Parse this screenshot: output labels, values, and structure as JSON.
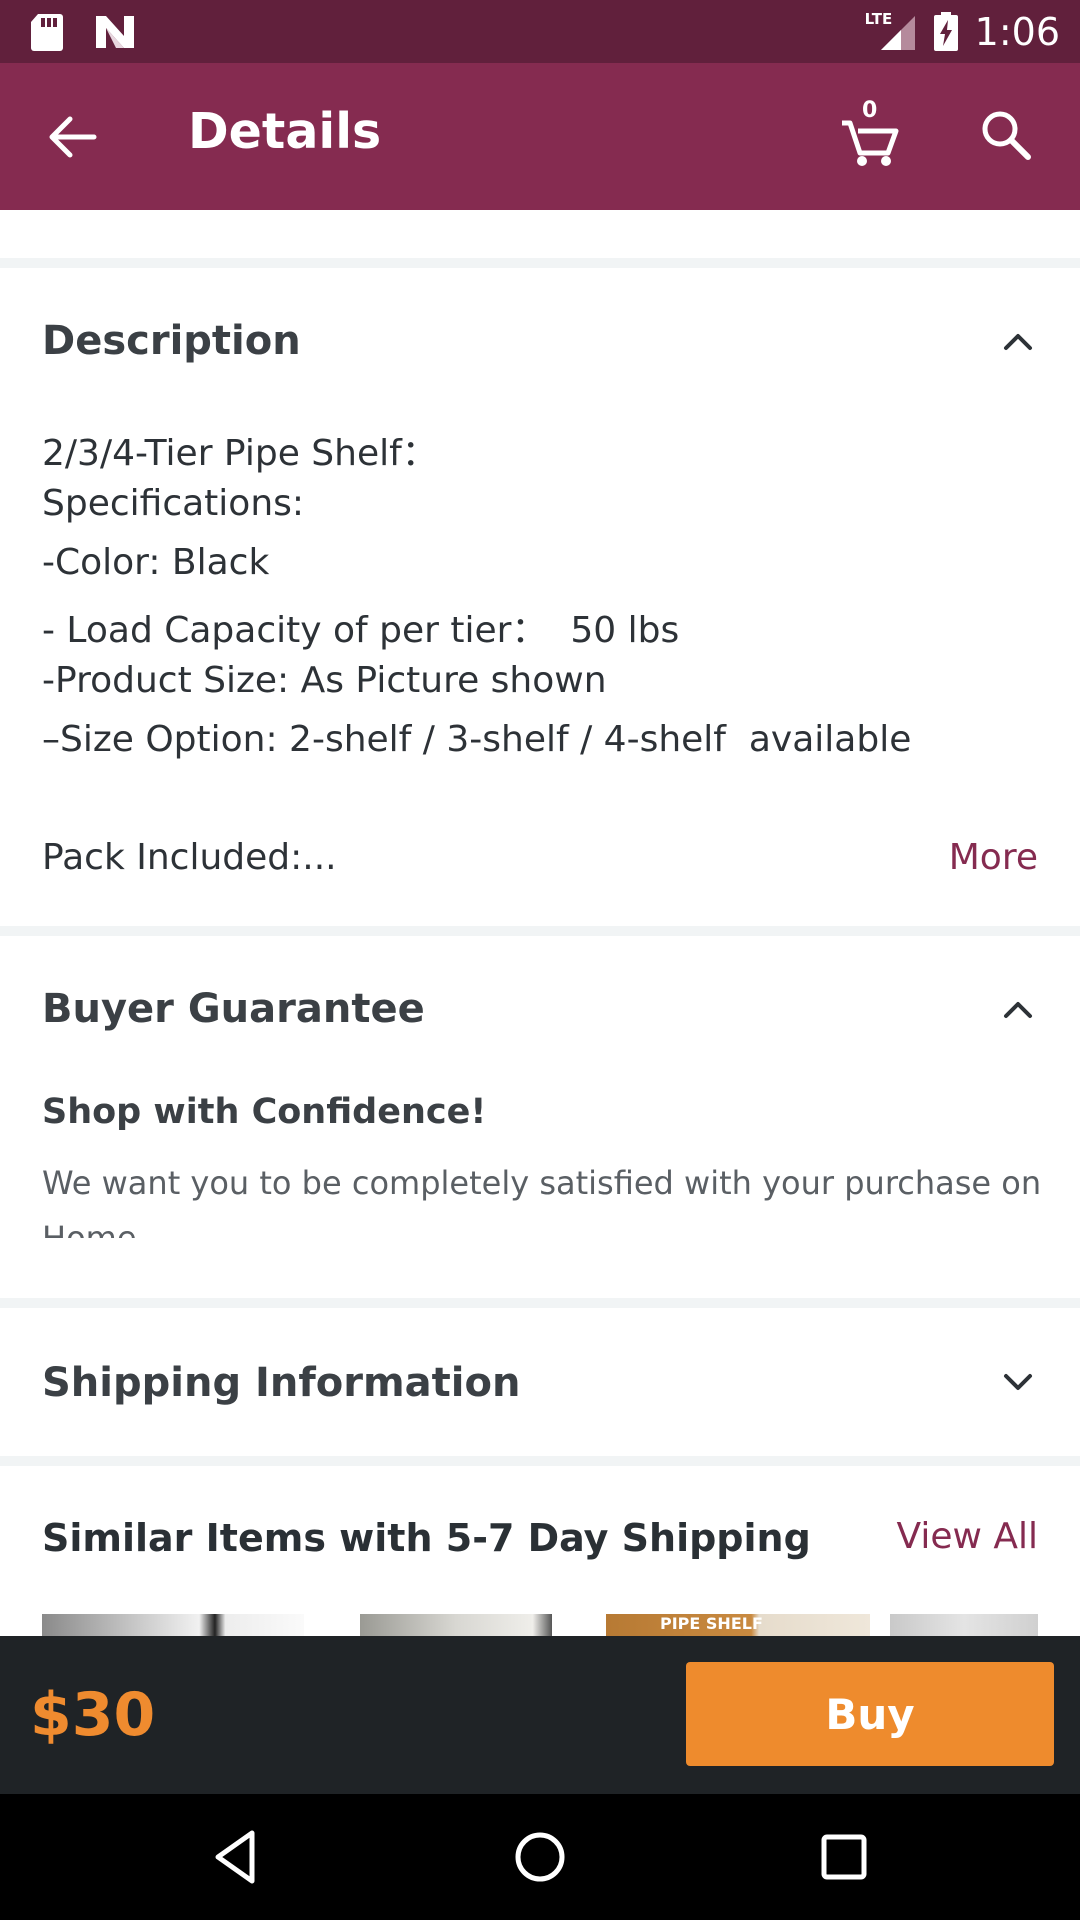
{
  "status_bar": {
    "time": "1:06",
    "network": "LTE",
    "icons": [
      "sd-card-icon",
      "n-logo-icon",
      "signal-icon",
      "battery-charging-icon"
    ]
  },
  "app_bar": {
    "title": "Details",
    "cart_count": "0",
    "icons": [
      "back-arrow-icon",
      "cart-icon",
      "search-icon"
    ]
  },
  "description": {
    "title": "Description",
    "lines": [
      "2/3/4-Tier Pipe Shelf：",
      "Specifications:",
      "-Color: Black",
      "- Load Capacity of per tier：  50 lbs",
      "-Product Size: As Picture shown",
      "–Size Option: 2-shelf / 3-shelf / 4-shelf  available"
    ],
    "pack_line": "Pack Included:...",
    "more_label": "More"
  },
  "buyer_guarantee": {
    "title": "Buyer Guarantee",
    "subtitle": "Shop with Confidence!",
    "text": "We want you to be completely satisfied with your purchase on Home"
  },
  "shipping": {
    "title": "Shipping Information"
  },
  "similar": {
    "title": "Similar Items with 5-7 Day Shipping",
    "view_all": "View All",
    "thumb_text": "PIPE SHELF"
  },
  "buy_bar": {
    "price": "$30",
    "buy_label": "Buy"
  },
  "colors": {
    "status_bar": "#61203c",
    "app_bar": "#852b50",
    "accent_link": "#852b50",
    "price": "#ef8b2f",
    "buy_button": "#ee8b2d",
    "buy_bar": "#1f2326"
  }
}
